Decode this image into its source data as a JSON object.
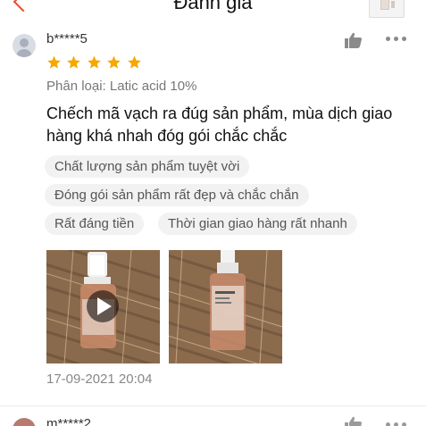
{
  "header": {
    "title": "Đánh giá"
  },
  "review": {
    "username": "b*****5",
    "rating": 5,
    "variant": "Phân loại: Latic acid 10%",
    "content": "Chếch mã vạch ra đúg sản phẩm, mùa dịch giao hàng khá nhah đóg gói chắc chắc",
    "tags": [
      "Chất lượng sản phẩm tuyệt vời",
      "Đóng gói sản phẩm rất đẹp và chắc chắn",
      "Rất đáng tiền",
      "Thời gian giao hàng rất nhanh"
    ],
    "timestamp": "17-09-2021 20:04"
  },
  "next_review": {
    "username": "m*****2"
  },
  "colors": {
    "accent": "#ee4d2d",
    "star": "#f6a700",
    "tag_bg": "#f2f2f2"
  }
}
